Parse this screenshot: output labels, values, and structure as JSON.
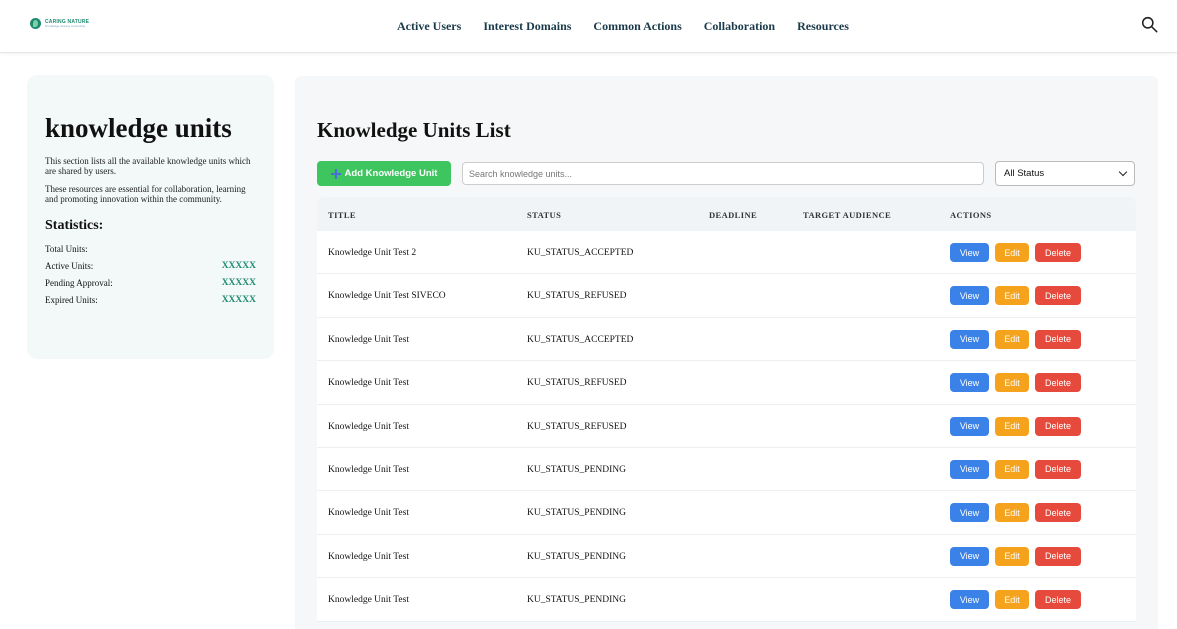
{
  "header": {
    "logo_title": "CARING NATURE",
    "logo_subtitle": "knowledge sharing community",
    "nav": [
      "Active Users",
      "Interest Domains",
      "Common Actions",
      "Collaboration",
      "Resources"
    ]
  },
  "sidebar": {
    "title": "knowledge units",
    "desc1": "This section lists all the available knowledge units which are shared by users.",
    "desc2": "These resources are essential for collaboration, learning and promoting innovation within the community.",
    "stats_title": "Statistics:",
    "stats": [
      {
        "label": "Total Units:",
        "value": ""
      },
      {
        "label": "Active Units:",
        "value": "XXXXX"
      },
      {
        "label": "Pending Approval:",
        "value": "XXXXX"
      },
      {
        "label": "Expired Units:",
        "value": "XXXXX"
      }
    ]
  },
  "main": {
    "title": "Knowledge Units List",
    "add_label": "Add Knowledge Unit",
    "search_placeholder": "Search knowledge units...",
    "status_filter": "All Status",
    "columns": [
      "TITLE",
      "STATUS",
      "DEADLINE",
      "TARGET AUDIENCE",
      "ACTIONS"
    ],
    "actions": {
      "view": "View",
      "edit": "Edit",
      "delete": "Delete"
    },
    "rows": [
      {
        "title": "Knowledge Unit Test 2",
        "status": "KU_STATUS_ACCEPTED",
        "deadline": "",
        "audience": ""
      },
      {
        "title": "Knowledge Unit Test SIVECO",
        "status": "KU_STATUS_REFUSED",
        "deadline": "",
        "audience": ""
      },
      {
        "title": "Knowledge Unit Test",
        "status": "KU_STATUS_ACCEPTED",
        "deadline": "",
        "audience": ""
      },
      {
        "title": "Knowledge Unit Test",
        "status": "KU_STATUS_REFUSED",
        "deadline": "",
        "audience": ""
      },
      {
        "title": "Knowledge Unit Test",
        "status": "KU_STATUS_REFUSED",
        "deadline": "",
        "audience": ""
      },
      {
        "title": "Knowledge Unit Test",
        "status": "KU_STATUS_PENDING",
        "deadline": "",
        "audience": ""
      },
      {
        "title": "Knowledge Unit Test",
        "status": "KU_STATUS_PENDING",
        "deadline": "",
        "audience": ""
      },
      {
        "title": "Knowledge Unit Test",
        "status": "KU_STATUS_PENDING",
        "deadline": "",
        "audience": ""
      },
      {
        "title": "Knowledge Unit Test",
        "status": "KU_STATUS_PENDING",
        "deadline": "",
        "audience": ""
      }
    ]
  },
  "colors": {
    "accent_green": "#3ec55f",
    "view_blue": "#3b82e8",
    "edit_orange": "#f5a21c",
    "delete_red": "#e64a3c",
    "brand": "#1f8a70"
  },
  "icons": {
    "search": "search-icon",
    "add": "plus-icon",
    "dropdown": "chevron-down-icon"
  }
}
